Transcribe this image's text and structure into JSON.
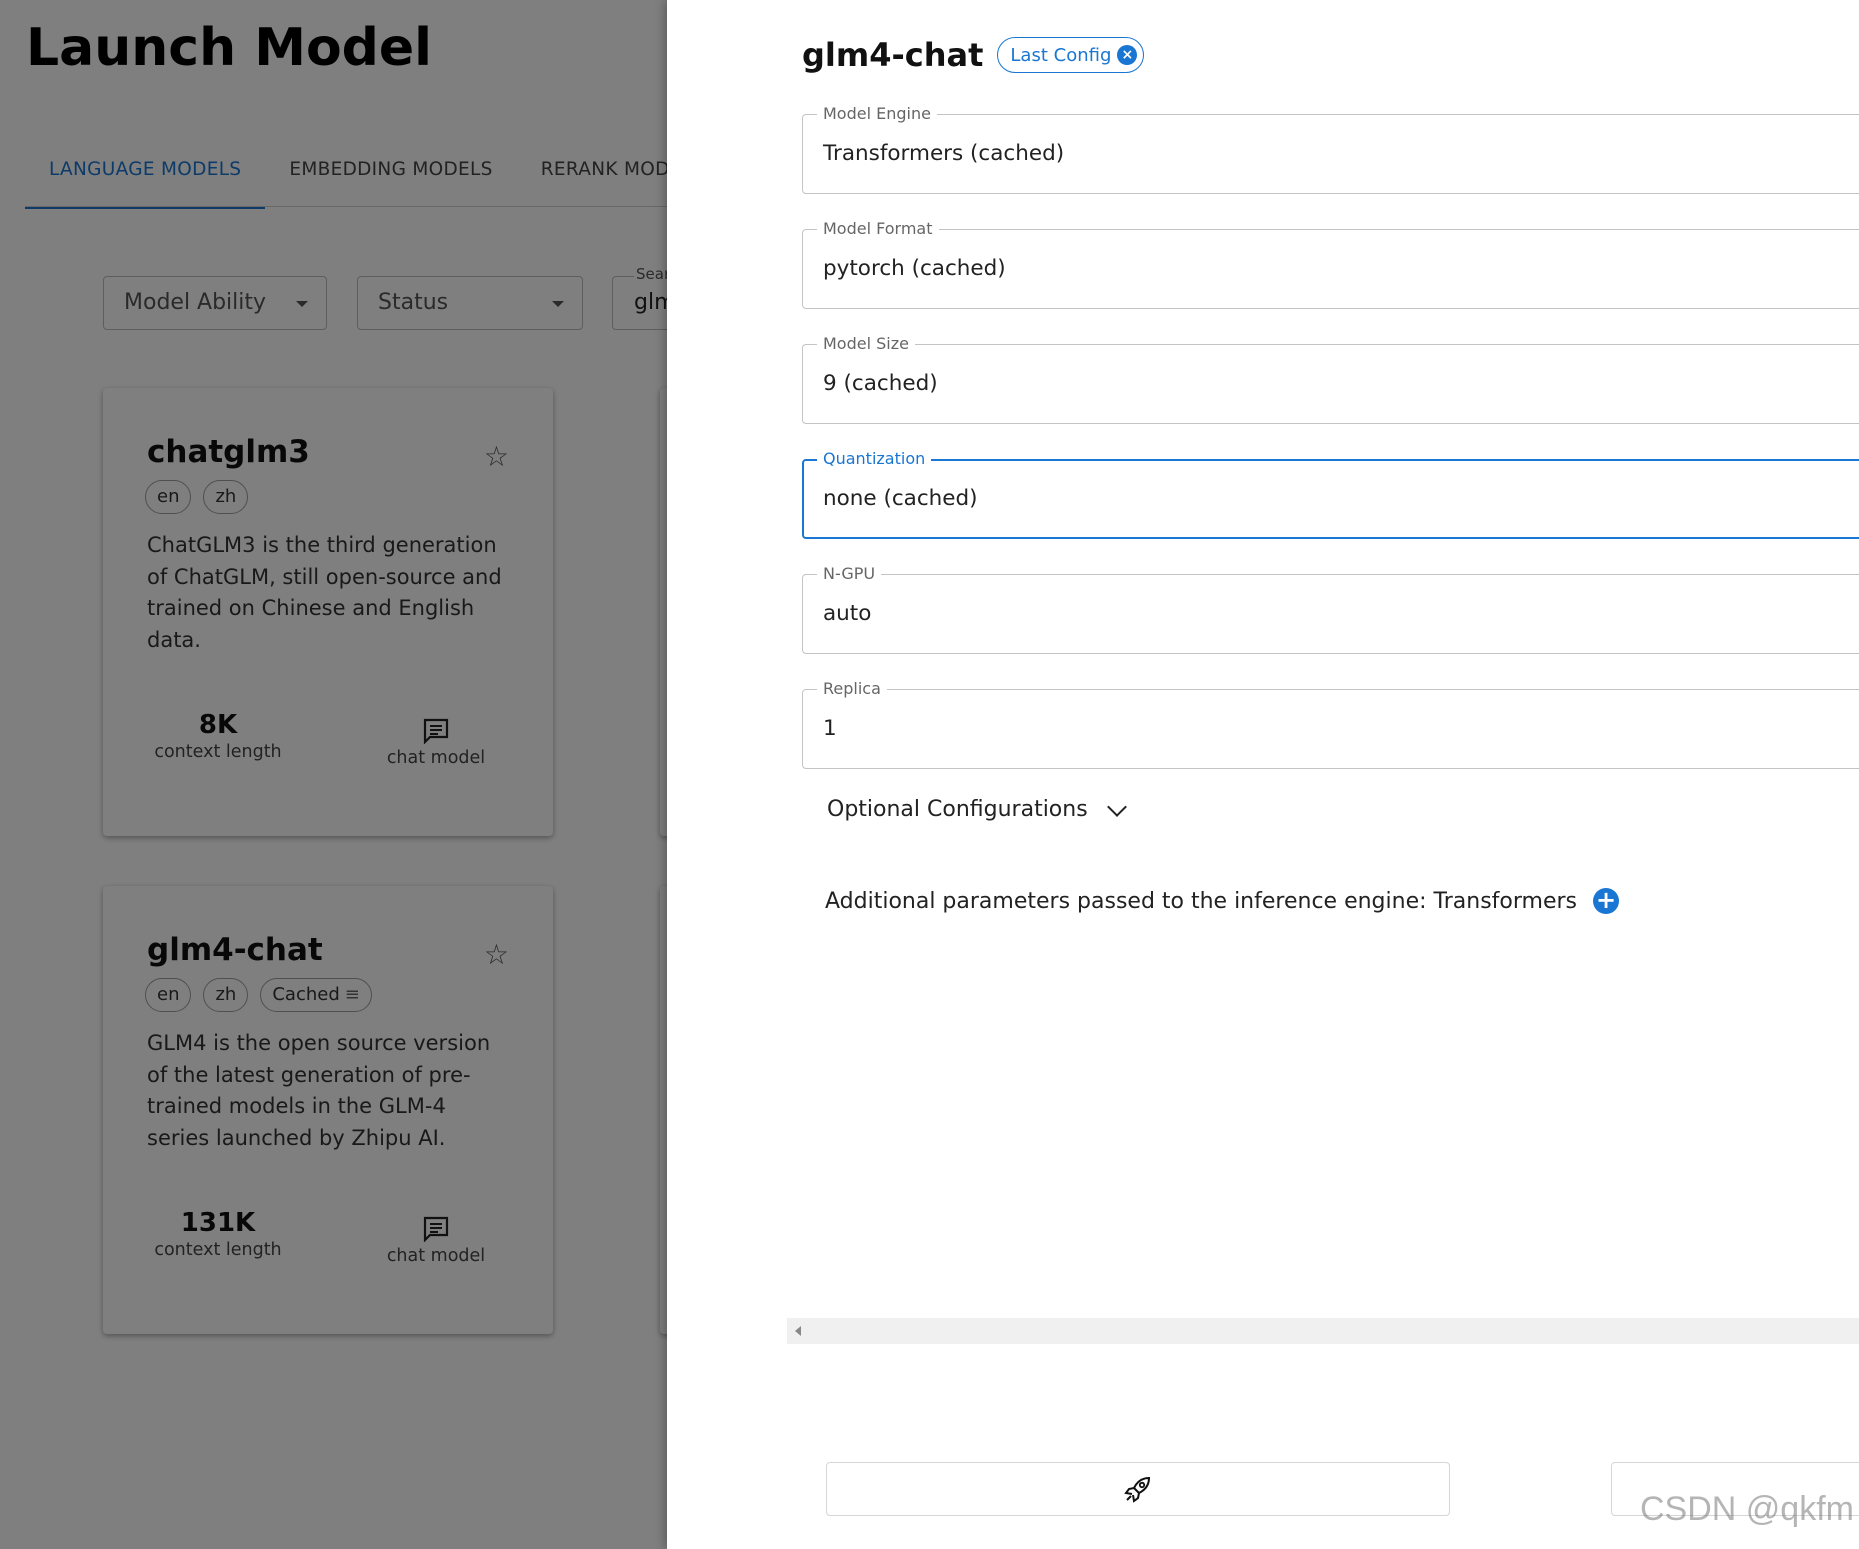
{
  "page": {
    "title": "Launch Model",
    "tabs": [
      "LANGUAGE MODELS",
      "EMBEDDING MODELS",
      "RERANK MODELS"
    ],
    "filters": {
      "ability_label": "Model Ability",
      "status_label": "Status",
      "search_label": "Sear",
      "search_value": "glm"
    },
    "cards": [
      {
        "name": "chatglm3",
        "chips": [
          "en",
          "zh"
        ],
        "description": "ChatGLM3 is the third generation of ChatGLM, still open-source and trained on Chinese and English data.",
        "context_value": "8K",
        "context_label": "context length",
        "type_label": "chat model"
      },
      {
        "name": "glm4-chat",
        "chips": [
          "en",
          "zh",
          "Cached"
        ],
        "description": "GLM4 is the open source version of the latest generation of pre-trained models in the GLM-4 series launched by Zhipu AI.",
        "context_value": "131K",
        "context_label": "context length",
        "type_label": "chat model"
      }
    ]
  },
  "drawer": {
    "title": "glm4-chat",
    "last_config_label": "Last Config",
    "fields": [
      {
        "label": "Model Engine",
        "value": "Transformers (cached)"
      },
      {
        "label": "Model Format",
        "value": "pytorch (cached)"
      },
      {
        "label": "Model Size",
        "value": "9 (cached)"
      },
      {
        "label": "Quantization",
        "value": "none (cached)"
      },
      {
        "label": "N-GPU",
        "value": "auto"
      },
      {
        "label": "Replica",
        "value": "1"
      }
    ],
    "optional_label": "Optional Configurations",
    "additional_label": "Additional parameters passed to the inference engine: Transformers"
  },
  "watermark": "CSDN @qkfm",
  "colors": {
    "accent": "#1976d2",
    "overlay": "rgba(0,0,0,0.5)"
  }
}
